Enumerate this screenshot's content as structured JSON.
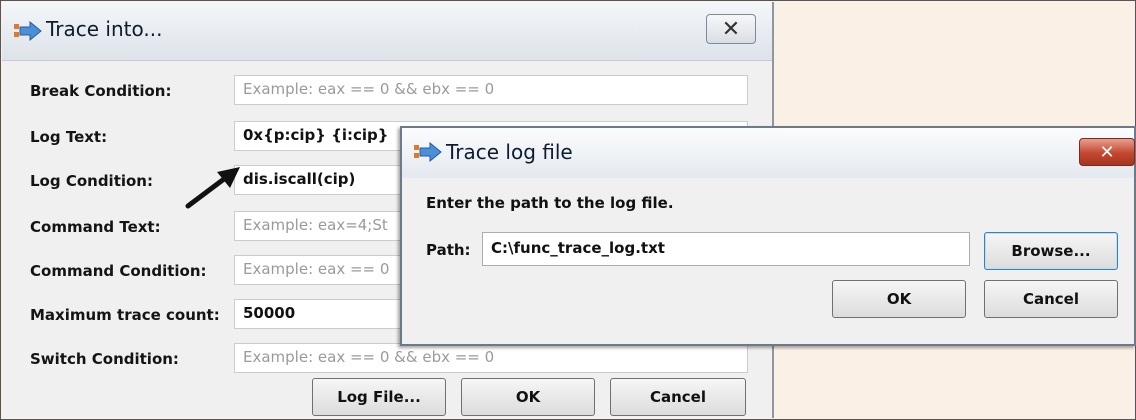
{
  "trace_into_dialog": {
    "title": "Trace into...",
    "title_icon": "arrow-app-icon",
    "close_icon": "close-icon",
    "fields": [
      {
        "label": "Break Condition:",
        "value": "",
        "placeholder": "Example: eax == 0 && ebx == 0"
      },
      {
        "label": "Log Text:",
        "value": "0x{p:cip} {i:cip}",
        "placeholder": ""
      },
      {
        "label": "Log Condition:",
        "value": "dis.iscall(cip)",
        "placeholder": ""
      },
      {
        "label": "Command Text:",
        "value": "",
        "placeholder": "Example: eax=4;St"
      },
      {
        "label": "Command Condition:",
        "value": "",
        "placeholder": "Example: eax == 0"
      },
      {
        "label": "Maximum trace count:",
        "value": "50000",
        "placeholder": ""
      },
      {
        "label": "Switch Condition:",
        "value": "",
        "placeholder": "Example: eax == 0 && ebx == 0"
      }
    ],
    "buttons": {
      "log_file": "Log File...",
      "ok": "OK",
      "cancel": "Cancel"
    }
  },
  "trace_log_dialog": {
    "title": "Trace log file",
    "title_icon": "arrow-app-icon",
    "close_icon": "close-icon",
    "prompt": "Enter the path to the log file.",
    "path_label": "Path:",
    "path_value": "C:\\func_trace_log.txt",
    "buttons": {
      "browse": "Browse...",
      "ok": "OK",
      "cancel": "Cancel"
    }
  },
  "colors": {
    "page_bg": "#faf0e6",
    "dialog_bg": "#f0f0f0",
    "close_red": "#c4472f",
    "placeholder_text": "#9a9a9a"
  }
}
